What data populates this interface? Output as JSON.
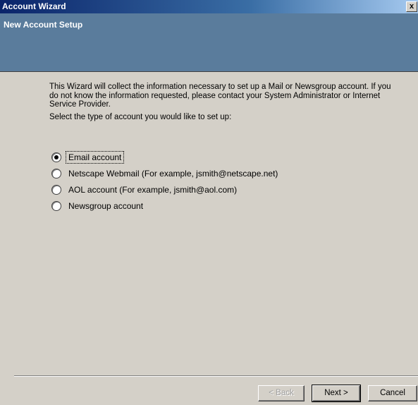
{
  "window": {
    "title": "Account Wizard",
    "close_glyph": "x"
  },
  "header": {
    "title": "New Account Setup"
  },
  "content": {
    "description": "This Wizard will collect the information necessary to set up a Mail or Newsgroup account. If you do not know the information requested, please contact your System Administrator or Internet Service Provider.",
    "prompt": "Select the type of account you would like to set up:"
  },
  "options": [
    {
      "label": "Email account",
      "selected": true
    },
    {
      "label": "Netscape Webmail (For example, jsmith@netscape.net)",
      "selected": false
    },
    {
      "label": "AOL account (For example, jsmith@aol.com)",
      "selected": false
    },
    {
      "label": "Newsgroup account",
      "selected": false
    }
  ],
  "buttons": {
    "back_label": "< Back",
    "next_label": "Next >",
    "cancel_label": "Cancel"
  },
  "colors": {
    "title_bar": "#0a246a",
    "header_banner": "#5a7c9c",
    "dialog_bg": "#d4d0c8"
  }
}
